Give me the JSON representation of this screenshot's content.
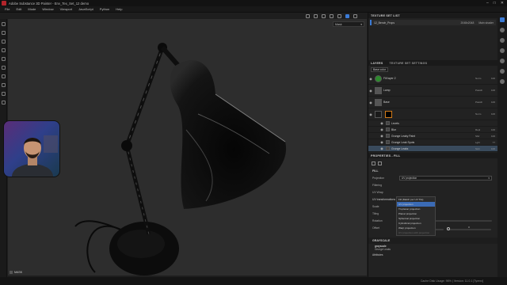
{
  "app": {
    "title": "Adobe Substance 3D Painter - Env_Tex_Set_12 demo",
    "menu": [
      "File",
      "Edit",
      "Mode",
      "Window",
      "Viewport",
      "JavaScript",
      "Python",
      "Help"
    ],
    "window_controls": [
      "–",
      "□",
      "✕"
    ]
  },
  "viewport": {
    "display_mode": "Mask",
    "mask_label": "MASK"
  },
  "texture_set_list": {
    "header": "TEXTURE SET LIST",
    "row": {
      "name": "12_Bench_Props",
      "resolution": "2048x2048",
      "shader": "Main shader"
    }
  },
  "layers_panel": {
    "tabs": [
      "LAYERS",
      "TEXTURE SET SETTINGS"
    ],
    "channel": "Base color",
    "layers": [
      {
        "name": "Fill layer 2",
        "blend": "Norm",
        "opacity": "100"
      },
      {
        "name": "Lamp",
        "blend": "Passth",
        "opacity": "100"
      },
      {
        "name": "Base",
        "blend": "Passth",
        "opacity": "100"
      },
      {
        "name": "",
        "blend": "Norm",
        "opacity": "100"
      }
    ],
    "effects": [
      {
        "name": "Levels",
        "blend": "",
        "opacity": ""
      },
      {
        "name": "Blur",
        "blend": "Repl",
        "opacity": "100"
      },
      {
        "name": "Grunge Leaky Paint",
        "blend": "Sbtr",
        "opacity": "100"
      },
      {
        "name": "Grunge Leak Spots",
        "blend": "Lght",
        "opacity": "77"
      },
      {
        "name": "Grunge Leaks",
        "blend": "Scrn",
        "opacity": "100"
      }
    ]
  },
  "properties": {
    "header": "PROPERTIES - FILL",
    "section": "FILL",
    "projection_label": "Projection",
    "projection_value": "UV projection",
    "filtering_label": "Filtering",
    "uv_wrap_label": "UV Wrap",
    "uv_transformations": "UV transformations",
    "scale_label": "Scale",
    "tiling_label": "Tiling",
    "rotation_label": "Rotation",
    "offset_label": "Offset",
    "offset_values": [
      "0",
      "0"
    ],
    "projection_options": [
      "Fill (Match per UV Tile)",
      "UV projection",
      "Tri-planar projection",
      "Planar projection",
      "Spherical projection",
      "Cylindrical projection",
      "Warp projection",
      "UV projection with projection"
    ],
    "selected_option": "UV projection",
    "grayscale_section": "GRAYSCALE",
    "grayscale_sub": "grayscale",
    "grayscale_source": "Grunge Leaks",
    "attributes": "Attributes"
  },
  "status": "Cache Disk Usage:  96% | Version: 11.0.1 [Tyrexx]",
  "colors": {
    "accent": "#3b7bd6",
    "selection": "#394a5c"
  }
}
